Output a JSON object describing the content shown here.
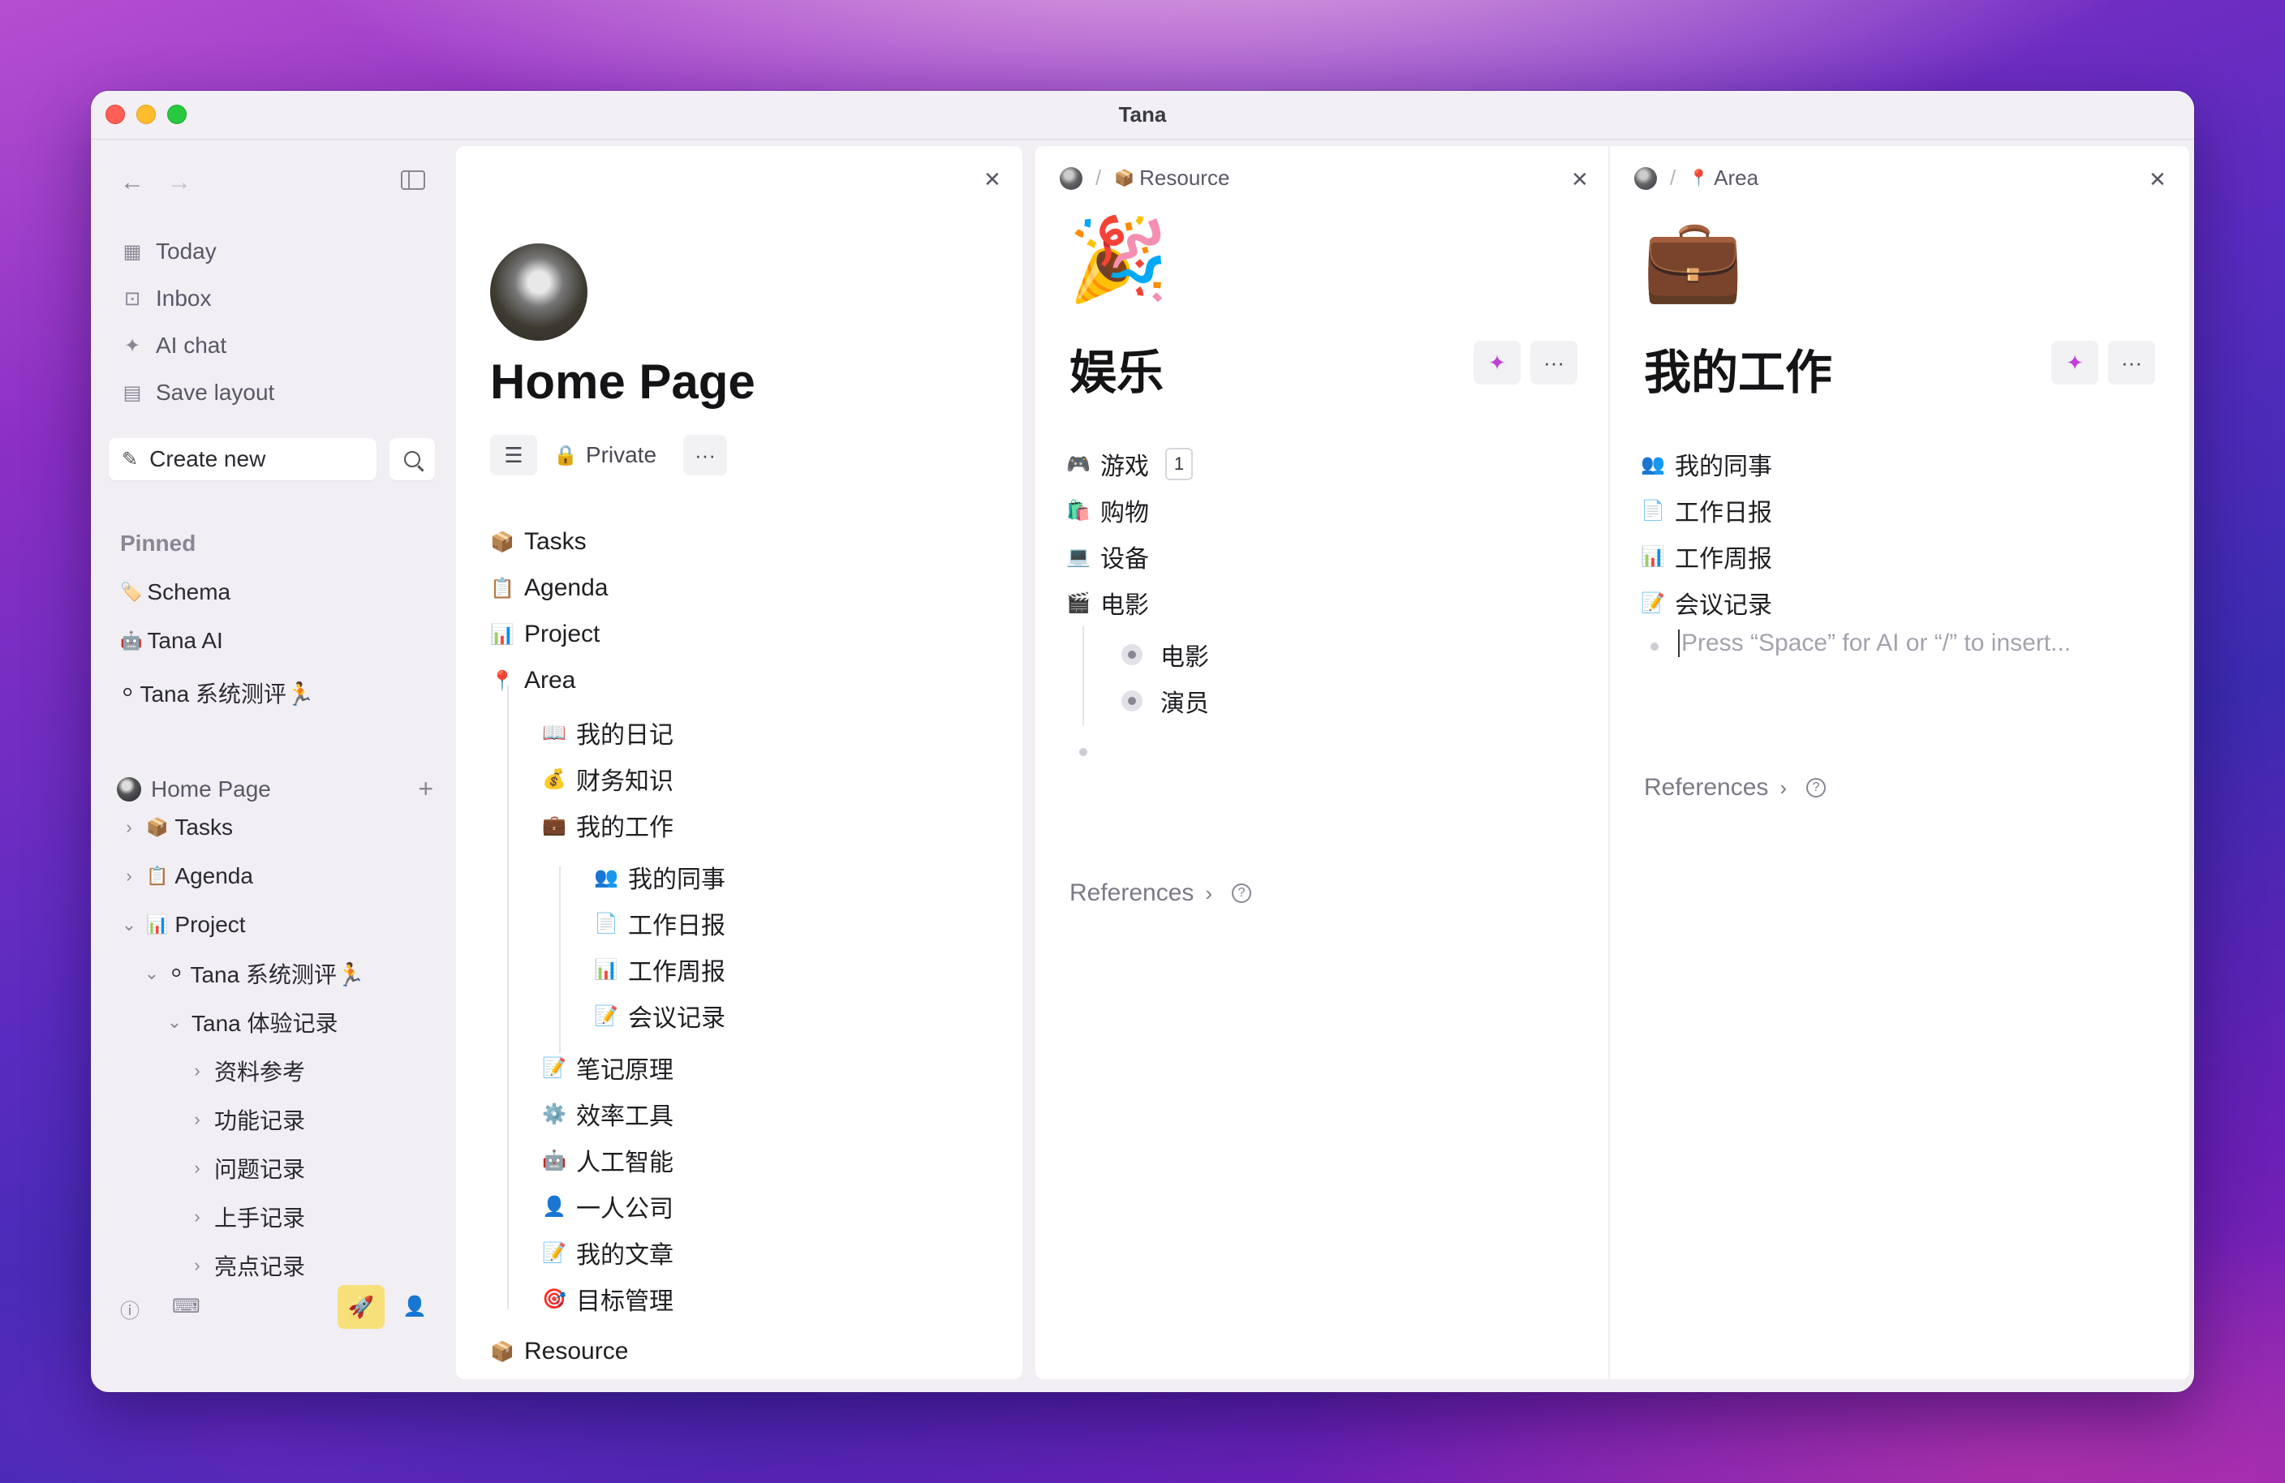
{
  "window": {
    "title": "Tana"
  },
  "sidebar": {
    "nav": [
      {
        "label": "Today",
        "icon": "calendar-icon"
      },
      {
        "label": "Inbox",
        "icon": "inbox-icon"
      },
      {
        "label": "AI chat",
        "icon": "sparkle-icon"
      },
      {
        "label": "Save layout",
        "icon": "layout-icon"
      }
    ],
    "create_new": "Create new",
    "pinned_heading": "Pinned",
    "pinned": [
      {
        "label": "Schema",
        "emoji": "🏷️"
      },
      {
        "label": "Tana AI",
        "emoji": "🤖"
      },
      {
        "label": "Tana 系统测评🏃",
        "emoji": "⚪"
      }
    ],
    "home_heading": "Home Page",
    "tree": [
      {
        "label": "Tasks",
        "emoji": "📦",
        "chevron": "›"
      },
      {
        "label": "Agenda",
        "emoji": "📋",
        "chevron": "›"
      },
      {
        "label": "Project",
        "emoji": "📊",
        "chevron": "⌄"
      },
      {
        "label": "Tana 系统测评🏃",
        "emoji": "⚪",
        "chevron": "⌄"
      },
      {
        "label": "Tana 体验记录",
        "emoji": "",
        "chevron": "⌄"
      },
      {
        "label": "资料参考",
        "emoji": "",
        "chevron": "›"
      },
      {
        "label": "功能记录",
        "emoji": "",
        "chevron": "›"
      },
      {
        "label": "问题记录",
        "emoji": "",
        "chevron": "›"
      },
      {
        "label": "上手记录",
        "emoji": "",
        "chevron": "›"
      },
      {
        "label": "亮点记录",
        "emoji": "",
        "chevron": "›"
      }
    ]
  },
  "panel_home": {
    "title": "Home Page",
    "privacy": "Private",
    "items": [
      {
        "label": "Tasks",
        "emoji": "📦"
      },
      {
        "label": "Agenda",
        "emoji": "📋"
      },
      {
        "label": "Project",
        "emoji": "📊"
      },
      {
        "label": "Area",
        "emoji": "📍"
      },
      {
        "label": "我的日记",
        "emoji": "📖"
      },
      {
        "label": "财务知识",
        "emoji": "💰"
      },
      {
        "label": "我的工作",
        "emoji": "💼"
      },
      {
        "label": "我的同事",
        "emoji": "👥"
      },
      {
        "label": "工作日报",
        "emoji": "📄"
      },
      {
        "label": "工作周报",
        "emoji": "📊"
      },
      {
        "label": "会议记录",
        "emoji": "📝"
      },
      {
        "label": "笔记原理",
        "emoji": "📝"
      },
      {
        "label": "效率工具",
        "emoji": "⚙️"
      },
      {
        "label": "人工智能",
        "emoji": "🤖"
      },
      {
        "label": "一人公司",
        "emoji": "👤"
      },
      {
        "label": "我的文章",
        "emoji": "📝"
      },
      {
        "label": "目标管理",
        "emoji": "🎯"
      },
      {
        "label": "Resource",
        "emoji": "📦"
      }
    ]
  },
  "panel_entertainment": {
    "breadcrumb": "Resource",
    "breadcrumb_emoji": "📦",
    "emoji": "🎉",
    "title": "娱乐",
    "items": [
      {
        "label": "游戏",
        "emoji": "🎮",
        "count": "1"
      },
      {
        "label": "购物",
        "emoji": "🛍️"
      },
      {
        "label": "设备",
        "emoji": "💻"
      },
      {
        "label": "电影",
        "emoji": "🎬"
      }
    ],
    "children": [
      {
        "label": "电影"
      },
      {
        "label": "演员"
      }
    ],
    "references": "References"
  },
  "panel_work": {
    "breadcrumb": "Area",
    "breadcrumb_emoji": "📍",
    "emoji": "💼",
    "title": "我的工作",
    "items": [
      {
        "label": "我的同事",
        "emoji": "👥"
      },
      {
        "label": "工作日报",
        "emoji": "📄"
      },
      {
        "label": "工作周报",
        "emoji": "📊"
      },
      {
        "label": "会议记录",
        "emoji": "📝"
      }
    ],
    "placeholder": "Press “Space” for AI or “/” to insert...",
    "references": "References"
  },
  "colors": {
    "accent": "#c13fd6",
    "rocket_bg": "#f7e07a"
  }
}
